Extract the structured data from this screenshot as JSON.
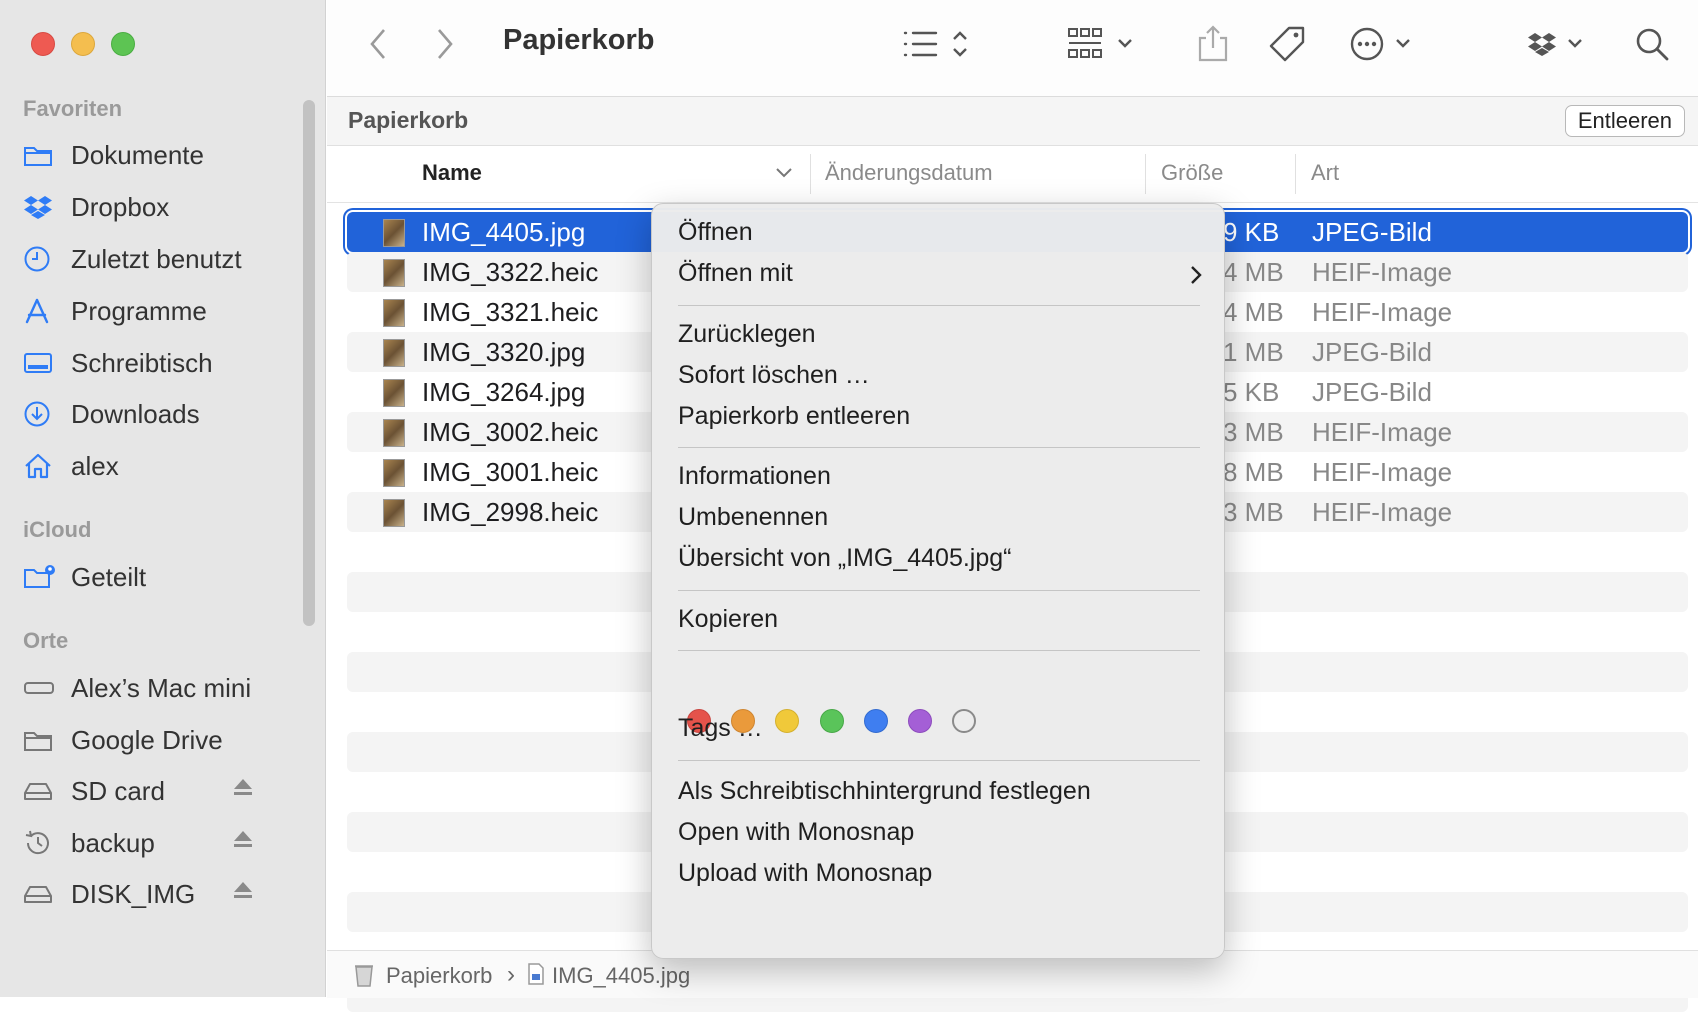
{
  "sidebar": {
    "sections": {
      "favorites": "Favoriten",
      "icloud": "iCloud",
      "locations": "Orte"
    },
    "favorites": [
      {
        "label": "Dokumente",
        "icon": "folder-icon"
      },
      {
        "label": "Dropbox",
        "icon": "dropbox-icon"
      },
      {
        "label": "Zuletzt benutzt",
        "icon": "clock-icon"
      },
      {
        "label": "Programme",
        "icon": "applications-icon"
      },
      {
        "label": "Schreibtisch",
        "icon": "desktop-icon"
      },
      {
        "label": "Downloads",
        "icon": "download-icon"
      },
      {
        "label": "alex",
        "icon": "home-icon"
      }
    ],
    "icloud": [
      {
        "label": "Geteilt",
        "icon": "shared-folder-icon"
      }
    ],
    "locations": [
      {
        "label": "Alex’s Mac mini",
        "icon": "computer-icon"
      },
      {
        "label": "Google Drive",
        "icon": "folder-icon"
      },
      {
        "label": "SD card",
        "icon": "drive-icon"
      },
      {
        "label": "backup",
        "icon": "time-machine-icon"
      },
      {
        "label": "DISK_IMG",
        "icon": "drive-icon"
      }
    ]
  },
  "toolbar": {
    "title": "Papierkorb"
  },
  "pathbar": {
    "title": "Papierkorb",
    "empty_button": "Entleeren"
  },
  "columns": {
    "name": "Name",
    "modified": "Änderungsdatum",
    "size": "Größe",
    "kind": "Art"
  },
  "files": [
    {
      "name": "IMG_4405.jpg",
      "size": "9 KB",
      "kind": "JPEG-Bild"
    },
    {
      "name": "IMG_3322.heic",
      "size": "4 MB",
      "kind": "HEIF-Image"
    },
    {
      "name": "IMG_3321.heic",
      "size": "4 MB",
      "kind": "HEIF-Image"
    },
    {
      "name": "IMG_3320.jpg",
      "size": "1 MB",
      "kind": "JPEG-Bild"
    },
    {
      "name": "IMG_3264.jpg",
      "size": "5 KB",
      "kind": "JPEG-Bild"
    },
    {
      "name": "IMG_3002.heic",
      "size": "3 MB",
      "kind": "HEIF-Image"
    },
    {
      "name": "IMG_3001.heic",
      "size": "8 MB",
      "kind": "HEIF-Image"
    },
    {
      "name": "IMG_2998.heic",
      "size": "3 MB",
      "kind": "HEIF-Image"
    }
  ],
  "statusbar": {
    "crumb1": "Papierkorb",
    "crumb2": "IMG_4405.jpg"
  },
  "context_menu": {
    "open": "Öffnen",
    "open_with": "Öffnen mit",
    "put_back": "Zurücklegen",
    "delete_now": "Sofort löschen …",
    "empty_trash": "Papierkorb entleeren",
    "info": "Informationen",
    "rename": "Umbenennen",
    "quicklook": "Übersicht von „IMG_4405.jpg“",
    "copy": "Kopieren",
    "tags": "Tags …",
    "set_wallpaper": "Als Schreibtischhintergrund festlegen",
    "open_monosnap": "Open with Monosnap",
    "upload_monosnap": "Upload with Monosnap",
    "tag_colors": [
      "#e5534b",
      "#ea9a3b",
      "#f0c93a",
      "#5ac45a",
      "#3f7ef0",
      "#a45fd6"
    ]
  }
}
